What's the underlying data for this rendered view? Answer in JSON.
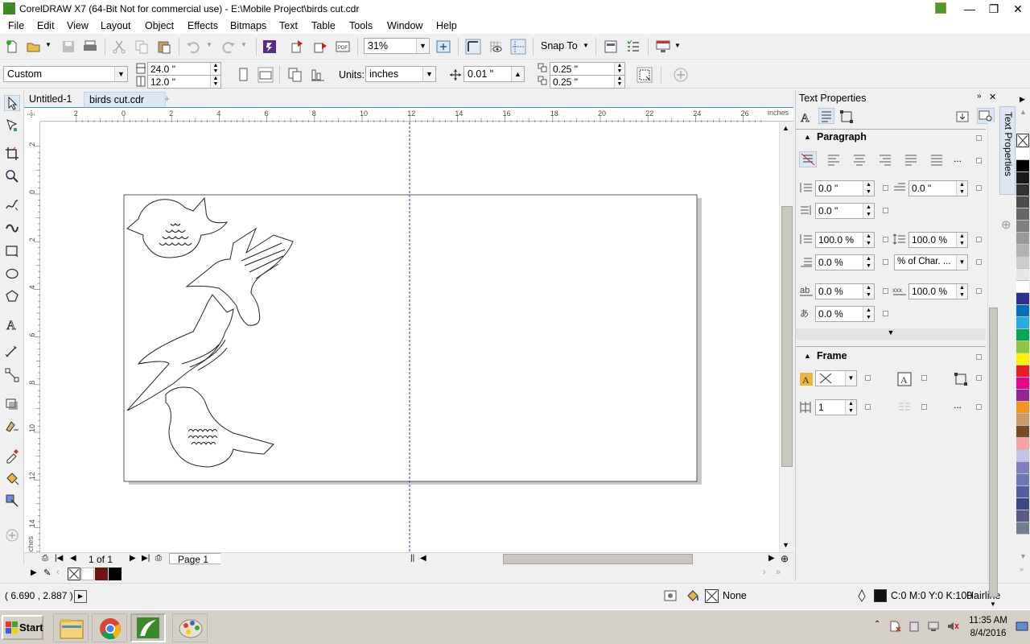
{
  "window": {
    "title": "CorelDRAW X7 (64-Bit Not for commercial use) - E:\\Mobile Project\\birds cut.cdr",
    "controls": {
      "minimize": "—",
      "restore": "❐",
      "close": "✕"
    }
  },
  "menu": {
    "items": [
      "File",
      "Edit",
      "View",
      "Layout",
      "Object",
      "Effects",
      "Bitmaps",
      "Text",
      "Table",
      "Tools",
      "Window",
      "Help"
    ]
  },
  "standard_toolbar": {
    "zoom_value": "31%",
    "snap_to_label": "Snap To"
  },
  "property_bar": {
    "page_size_preset": "Custom",
    "page_width": "24.0 \"",
    "page_height": "12.0 \"",
    "units_label": "Units:",
    "units_value": "inches",
    "nudge_value": "0.01 \"",
    "duplicate_x": "0.25 \"",
    "duplicate_y": "0.25 \""
  },
  "document_tabs": [
    {
      "label": "Untitled-1",
      "active": false
    },
    {
      "label": "birds cut.cdr",
      "active": true
    }
  ],
  "rulers": {
    "unit_label": "inches",
    "h_ticks": [
      "2",
      "0",
      "2",
      "4",
      "6",
      "8",
      "10",
      "12",
      "14",
      "16",
      "18",
      "20",
      "22",
      "24",
      "26"
    ],
    "v_ticks": [
      "2",
      "0",
      "2",
      "4",
      "6",
      "8",
      "10",
      "12",
      "14"
    ]
  },
  "page_navigator": {
    "page_count_text": "1 of 1",
    "page_tab_label": "Page 1"
  },
  "status_bar": {
    "cursor_coords": "( 6.690 , 2.887 )",
    "fill_label": "None",
    "outline_color_text": "C:0 M:0 Y:0 K:100",
    "outline_width": "Hairline"
  },
  "docker": {
    "title": "Text Properties",
    "vertical_tab_label": "Text Properties",
    "paragraph": {
      "header": "Paragraph",
      "left_indent": "0.0 \"",
      "first_line_indent": "0.0 \"",
      "right_indent": "0.0 \"",
      "line_spacing": "100.0 %",
      "before_paragraph": "100.0 %",
      "after_paragraph": "0.0 %",
      "spacing_unit": "% of Char. ...",
      "char_spacing": "0.0 %",
      "word_spacing": "100.0 %",
      "language_spacing": "0.0 %",
      "more_label": "..."
    },
    "frame": {
      "header": "Frame",
      "columns": "1",
      "more_label": "..."
    }
  },
  "palette_colors": [
    "#ffffff",
    "#000000",
    "#1a1a1a",
    "#333333",
    "#4d4d4d",
    "#666666",
    "#808080",
    "#999999",
    "#b3b3b3",
    "#cccccc",
    "#e6e6e6",
    "#ffffff",
    "#2e3192",
    "#0071bc",
    "#29abe2",
    "#00a651",
    "#8dc63f",
    "#fff200",
    "#ed1c24",
    "#ec008c",
    "#92278f",
    "#f7941d",
    "#c69c6d",
    "#754c24",
    "#f9a1a6",
    "#c4c4e6",
    "#8080c0",
    "#6a7ab5",
    "#4f5fa0",
    "#3b4885",
    "#5a5a8a",
    "#708090"
  ],
  "taskbar": {
    "start_label": "Start",
    "time": "11:35 AM",
    "date": "8/4/2016"
  }
}
